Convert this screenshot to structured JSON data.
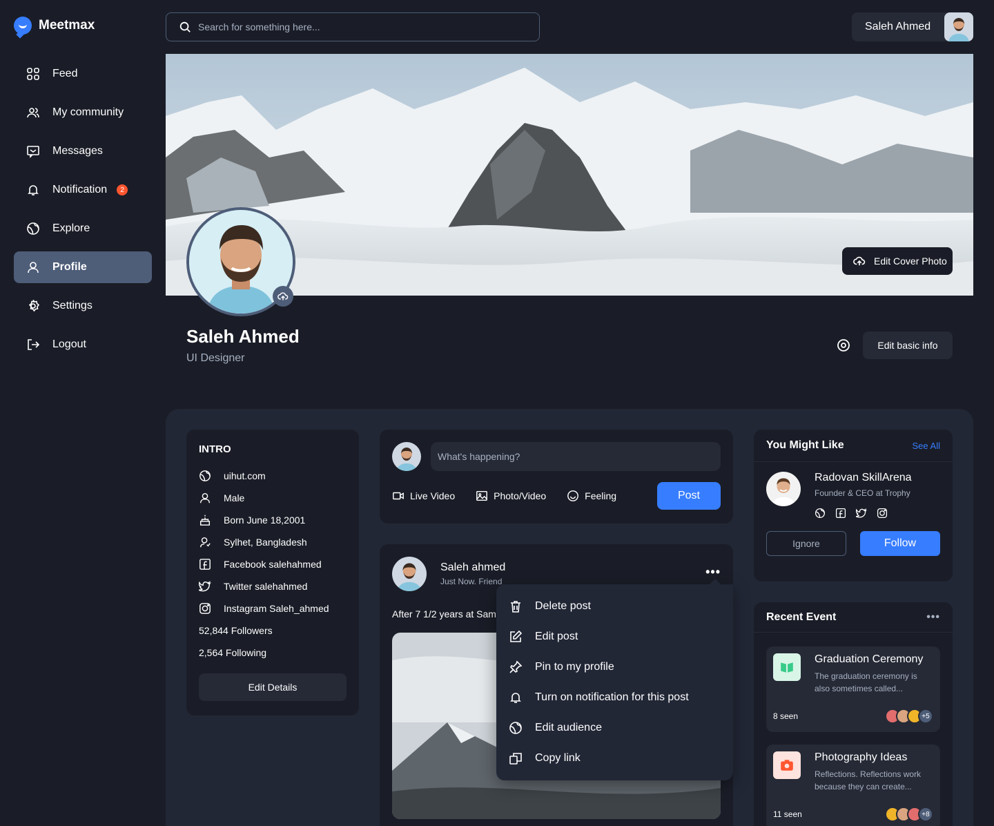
{
  "app": {
    "name": "Meetmax"
  },
  "nav": {
    "items": [
      {
        "label": "Feed",
        "icon": "grid-icon"
      },
      {
        "label": "My community",
        "icon": "users-icon"
      },
      {
        "label": "Messages",
        "icon": "message-icon"
      },
      {
        "label": "Notification",
        "icon": "bell-icon",
        "badge": "2"
      },
      {
        "label": "Explore",
        "icon": "globe-icon"
      },
      {
        "label": "Profile",
        "icon": "user-icon",
        "active": true
      },
      {
        "label": "Settings",
        "icon": "gear-icon"
      },
      {
        "label": "Logout",
        "icon": "logout-icon"
      }
    ]
  },
  "search": {
    "placeholder": "Search for something here..."
  },
  "user": {
    "name": "Saleh Ahmed"
  },
  "cover": {
    "edit_label": "Edit Cover Photo"
  },
  "profile": {
    "name": "Saleh Ahmed",
    "role": "UI Designer",
    "edit_label": "Edit basic info"
  },
  "intro": {
    "title": "INTRO",
    "rows": [
      {
        "icon": "globe-icon",
        "text": "uihut.com"
      },
      {
        "icon": "user-icon",
        "text": "Male"
      },
      {
        "icon": "cake-icon",
        "text": "Born June 18,2001"
      },
      {
        "icon": "location-icon",
        "text": "Sylhet, Bangladesh"
      },
      {
        "icon": "facebook-icon",
        "text": "Facebook salehahmed"
      },
      {
        "icon": "twitter-icon",
        "text": "Twitter salehahmed"
      },
      {
        "icon": "instagram-icon",
        "text": "Instagram Saleh_ahmed"
      }
    ],
    "followers": "52,844 Followers",
    "following": "2,564 Following",
    "edit_label": "Edit Details"
  },
  "composer": {
    "placeholder": "What's happening?",
    "live": "Live Video",
    "photo": "Photo/Video",
    "feeling": "Feeling",
    "post": "Post"
  },
  "post": {
    "author": "Saleh ahmed",
    "meta": "Just Now. Friend",
    "text": "After 7 1/2 years at Sam an amazing company an"
  },
  "menu": {
    "items": [
      {
        "label": "Delete post",
        "icon": "trash-icon"
      },
      {
        "label": "Edit post",
        "icon": "edit-icon"
      },
      {
        "label": "Pin to my profile",
        "icon": "pin-icon"
      },
      {
        "label": "Turn on notification for this post",
        "icon": "bell-icon"
      },
      {
        "label": "Edit audience",
        "icon": "globe-icon"
      },
      {
        "label": "Copy link",
        "icon": "copy-icon"
      }
    ]
  },
  "might_like": {
    "title": "You Might Like",
    "see_all": "See All",
    "name": "Radovan SkillArena",
    "sub": "Founder & CEO at Trophy",
    "ignore": "Ignore",
    "follow": "Follow"
  },
  "recent": {
    "title": "Recent Event",
    "events": [
      {
        "title": "Graduation Ceremony",
        "desc": "The graduation ceremony is also sometimes called...",
        "seen": "8 seen",
        "more": "+5",
        "icon_color": "#d8f5e8",
        "icon": "book-icon"
      },
      {
        "title": "Photography Ideas",
        "desc": "Reflections. Reflections work because they can create...",
        "seen": "11 seen",
        "more": "+8",
        "icon_color": "#ffe3de",
        "icon": "camera-icon"
      }
    ]
  },
  "colors": {
    "accent": "#377dff",
    "bg": "#1a1d27",
    "panel": "#222736",
    "badge": "#ff5630"
  }
}
